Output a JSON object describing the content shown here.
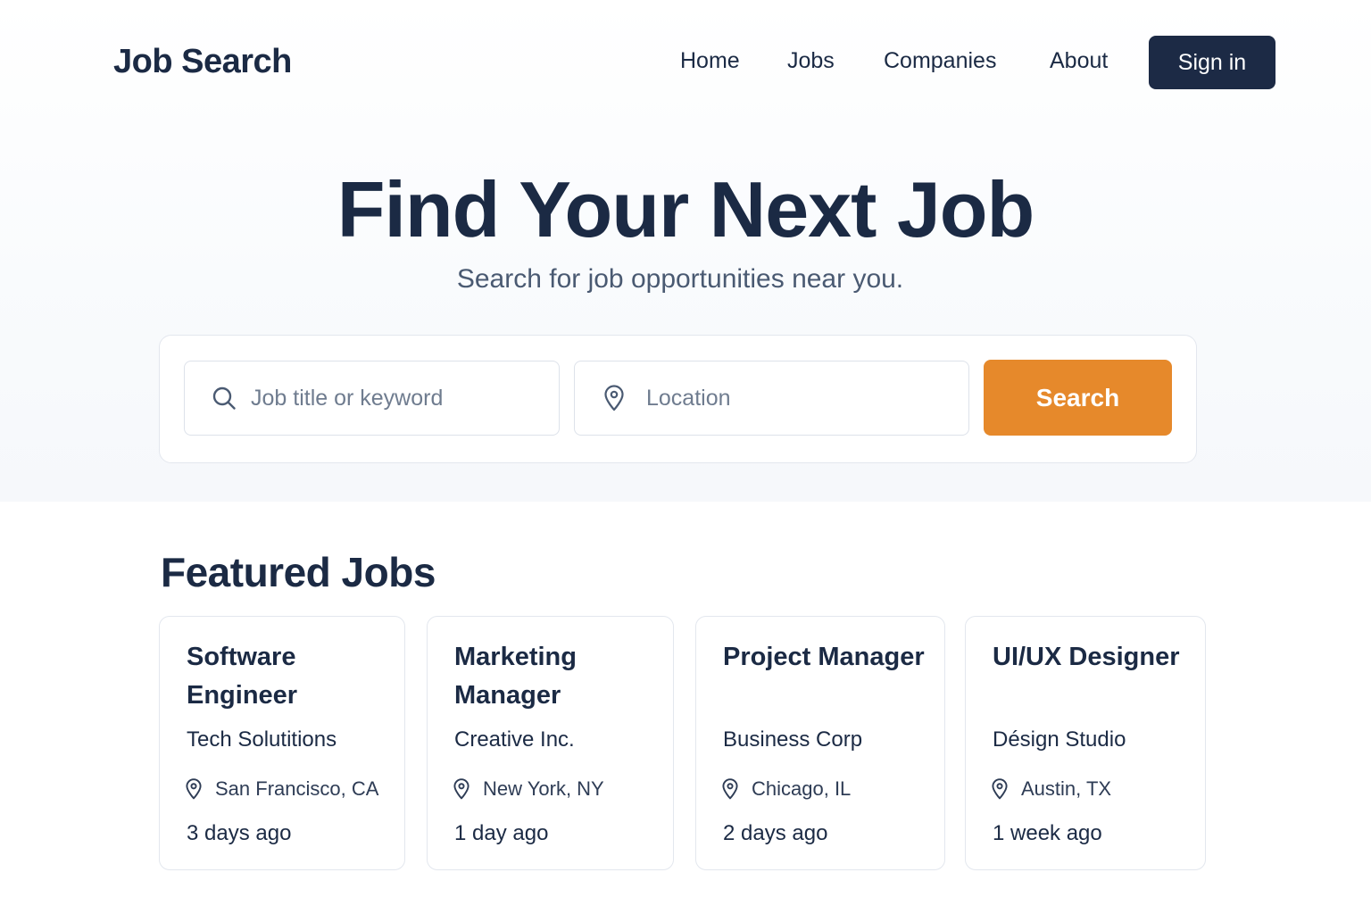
{
  "header": {
    "brand": "Job Search",
    "nav": [
      {
        "label": "Home"
      },
      {
        "label": "Jobs"
      },
      {
        "label": "Companies"
      },
      {
        "label": "About"
      }
    ],
    "sign_in": "Sign in"
  },
  "hero": {
    "title": "Find Your Next Job",
    "subtitle": "Search for job opportunities near you."
  },
  "search": {
    "keyword_placeholder": "Job title or keyword",
    "keyword_value": "",
    "location_placeholder": "Location",
    "location_value": "",
    "button_label": "Search"
  },
  "featured": {
    "title": "Featured Jobs",
    "jobs": [
      {
        "title": "Software Engineer",
        "company": "Tech Solutitions",
        "location": "San Francisco, CA",
        "posted": "3 days ago"
      },
      {
        "title": "Marketing Manager",
        "company": "Creative Inc.",
        "location": "New York, NY",
        "posted": "1 day ago"
      },
      {
        "title": "Project Manager",
        "company": "Business Corp",
        "location": "Chicago, IL",
        "posted": "2 days ago"
      },
      {
        "title": "UI/UX Designer",
        "company": "Désign Studio",
        "location": "Austin, TX",
        "posted": "1 week ago"
      }
    ]
  },
  "icons": {
    "keyword_field": "search-icon",
    "location_field": "map-pin-icon",
    "job_location": "map-pin-icon"
  },
  "colors": {
    "primary_dark": "#1c2a45",
    "accent_orange": "#e6892b",
    "muted_text": "#4a5a72"
  }
}
